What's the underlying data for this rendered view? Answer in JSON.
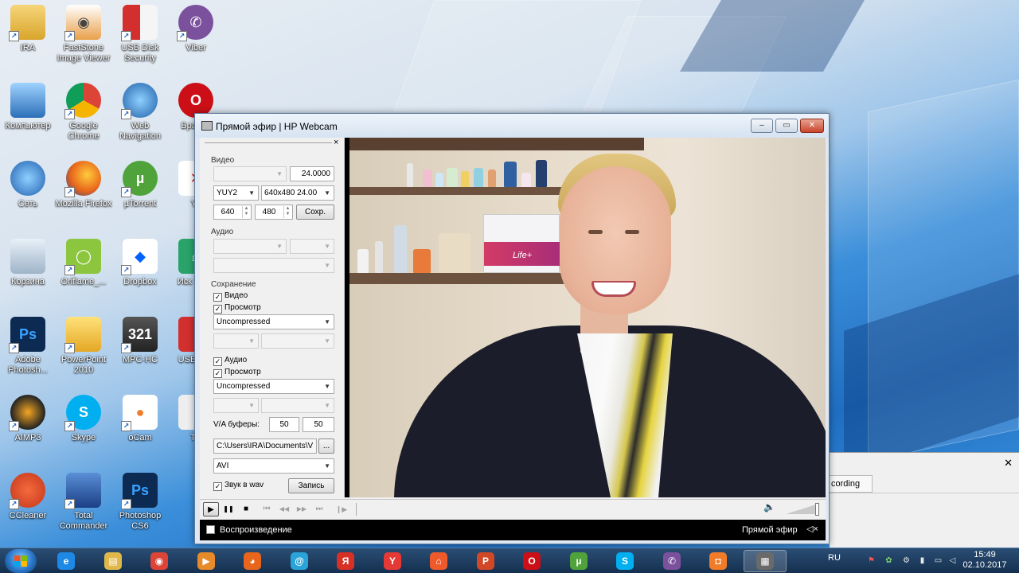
{
  "desktop": {
    "icons": [
      {
        "label": "IRA"
      },
      {
        "label": "FastStone Image Viewer"
      },
      {
        "label": "USB Disk Security"
      },
      {
        "label": "Viber"
      },
      {
        "label": "Компьютер"
      },
      {
        "label": "Google Chrome"
      },
      {
        "label": "Web Navigation"
      },
      {
        "label": "Бра Op"
      },
      {
        "label": "Сеть"
      },
      {
        "label": "Mozilla Firefox"
      },
      {
        "label": "µTorrent"
      },
      {
        "label": "Ya"
      },
      {
        "label": "Корзина"
      },
      {
        "label": "Oriflame_..."
      },
      {
        "label": "Dropbox"
      },
      {
        "label": "Иск Инте"
      },
      {
        "label": "Adobe Photosh..."
      },
      {
        "label": "PowerPoint 2010"
      },
      {
        "label": "MPC-HC"
      },
      {
        "label": "USB Sec"
      },
      {
        "label": "AIMP3"
      },
      {
        "label": "Skype"
      },
      {
        "label": "oCam"
      },
      {
        "label": "TE"
      },
      {
        "label": "CCleaner"
      },
      {
        "label": "Total Commander"
      },
      {
        "label": "Photoshop CS6"
      }
    ]
  },
  "window": {
    "title": "Прямой эфир | HP Webcam",
    "min_glyph": "‒",
    "max_glyph": "▭",
    "close_glyph": "✕",
    "panel_close": "×"
  },
  "panel": {
    "video_group": "Видео",
    "video_device": "",
    "fps": "24.0000",
    "format": "YUY2",
    "resolution": "640x480 24.00",
    "width": "640",
    "height": "480",
    "save_button": "Сохр.",
    "audio_group": "Аудио",
    "save_group": "Сохранение",
    "save_video_chk": "Видео",
    "preview_video_chk": "Просмотр",
    "video_codec": "Uncompressed",
    "save_audio_chk": "Аудио",
    "preview_audio_chk": "Просмотр",
    "audio_codec": "Uncompressed",
    "buffers_label": "V/A буферы:",
    "video_buffer": "50",
    "audio_buffer": "50",
    "path": "C:\\Users\\IRA\\Documents\\V",
    "browse_button": "...",
    "container": "AVI",
    "wav_chk": "Звук в wav",
    "record_button": "Запись"
  },
  "video_scene": {
    "box_label": "Life+"
  },
  "transport": {
    "play": "▶",
    "pause": "❚❚",
    "stop": "■",
    "prev": "⏮",
    "rew": "◀◀",
    "fwd": "▶▶",
    "next": "⏭",
    "frame": "❙▶",
    "volume_icon": "🔈"
  },
  "status": {
    "left": "Воспроизведение",
    "right": "Прямой эфир",
    "mute": "◁×"
  },
  "background_window": {
    "close": "✕",
    "tab": "cording"
  },
  "taskbar": {
    "apps": [
      {
        "name": "ie",
        "glyph": "e",
        "color": "#1e88e5"
      },
      {
        "name": "explorer",
        "glyph": "▤",
        "color": "#e0b84a"
      },
      {
        "name": "chrome",
        "glyph": "◉",
        "color": "#db4437"
      },
      {
        "name": "media",
        "glyph": "▶",
        "color": "#e78a2a"
      },
      {
        "name": "firefox",
        "glyph": "◕",
        "color": "#e8661c"
      },
      {
        "name": "mail",
        "glyph": "@",
        "color": "#2aa3d8"
      },
      {
        "name": "yandex-app",
        "glyph": "Я",
        "color": "#d93025"
      },
      {
        "name": "yandex-browser",
        "glyph": "Y",
        "color": "#e53935"
      },
      {
        "name": "shop",
        "glyph": "⌂",
        "color": "#ef5a2a"
      },
      {
        "name": "powerpoint",
        "glyph": "P",
        "color": "#d24726"
      },
      {
        "name": "opera",
        "glyph": "O",
        "color": "#cc0f16"
      },
      {
        "name": "utorrent",
        "glyph": "µ",
        "color": "#4fa33a"
      },
      {
        "name": "skype",
        "glyph": "S",
        "color": "#00aff0"
      },
      {
        "name": "viber",
        "glyph": "✆",
        "color": "#7b519d"
      },
      {
        "name": "ocam",
        "glyph": "◘",
        "color": "#f07c2a"
      },
      {
        "name": "mpc",
        "glyph": "▦",
        "color": "#6a6a6a"
      }
    ],
    "lang": "RU",
    "time": "15:49",
    "date": "02.10.2017"
  }
}
